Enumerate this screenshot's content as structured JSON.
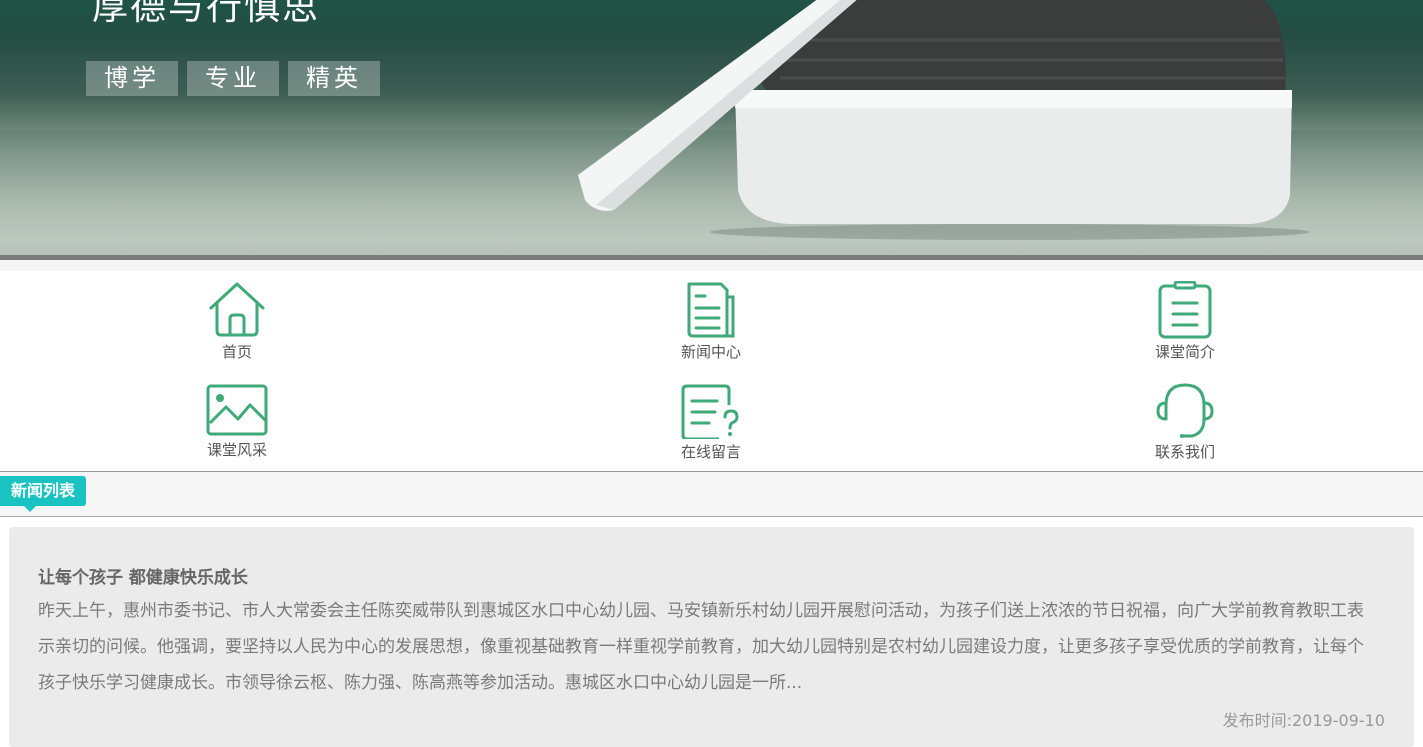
{
  "banner": {
    "headline": "厚德与行慎思",
    "tags": [
      "博学",
      "专业",
      "精英"
    ]
  },
  "nav": {
    "items": [
      {
        "label": "首页",
        "icon": "home-icon"
      },
      {
        "label": "新闻中心",
        "icon": "news-document-icon"
      },
      {
        "label": "课堂简介",
        "icon": "clipboard-icon"
      },
      {
        "label": "课堂风采",
        "icon": "image-icon"
      },
      {
        "label": "在线留言",
        "icon": "message-question-icon"
      },
      {
        "label": "联系我们",
        "icon": "headset-icon"
      }
    ],
    "icon_color": "#3fa978"
  },
  "section": {
    "title": "新闻列表",
    "accent": "#19c3c1"
  },
  "news": [
    {
      "title": "让每个孩子 都健康快乐成长",
      "summary": "昨天上午，惠州市委书记、市人大常委会主任陈奕威带队到惠城区水口中心幼儿园、马安镇新乐村幼儿园开展慰问活动，为孩子们送上浓浓的节日祝福，向广大学前教育教职工表示亲切的问候。他强调，要坚持以人民为中心的发展思想，像重视基础教育一样重视学前教育，加大幼儿园特别是农村幼儿园建设力度，让更多孩子享受优质的学前教育，让每个孩子快乐学习健康成长。市领导徐云枢、陈力强、陈高燕等参加活动。惠城区水口中心幼儿园是一所...",
      "date": "发布时间:2019-09-10"
    }
  ]
}
